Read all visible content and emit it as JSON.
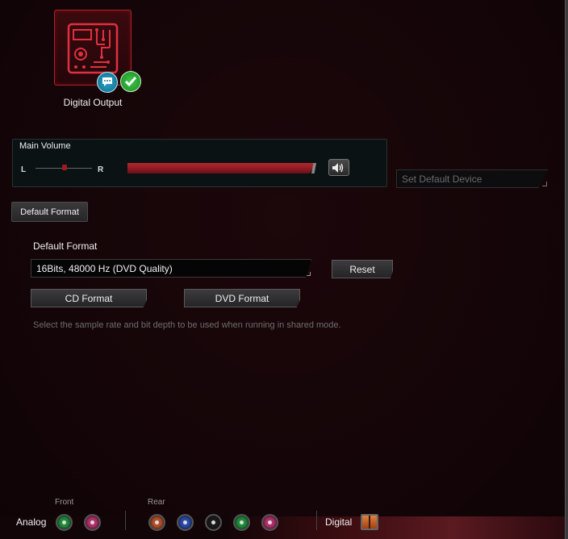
{
  "device": {
    "label": "Digital Output",
    "icon": "circuit-board-icon",
    "badges": [
      "chat-bubble-icon",
      "checkmark-icon"
    ]
  },
  "volume": {
    "title": "Main Volume",
    "left_label": "L",
    "right_label": "R",
    "level_percent": 100,
    "balance_percent": 50,
    "mute_icon": "speaker-icon"
  },
  "set_default_device": {
    "placeholder": "Set Default Device"
  },
  "tabs": {
    "default_format": "Default Format"
  },
  "format": {
    "section_title": "Default Format",
    "selected": "16Bits, 48000 Hz (DVD Quality)",
    "reset_label": "Reset",
    "cd_label": "CD Format",
    "dvd_label": "DVD Format",
    "hint": "Select the sample rate and bit depth to be used when running in shared mode."
  },
  "jacks": {
    "analog_label": "Analog",
    "front_label": "Front",
    "rear_label": "Rear",
    "digital_label": "Digital",
    "front": [
      {
        "name": "front-green",
        "color": "#1f8a3a"
      },
      {
        "name": "front-pink",
        "color": "#b0306a"
      }
    ],
    "rear": [
      {
        "name": "rear-orange",
        "color": "#b0502a"
      },
      {
        "name": "rear-blue",
        "color": "#2a4aa8"
      },
      {
        "name": "rear-black",
        "color": "#1a1a1a"
      },
      {
        "name": "rear-green",
        "color": "#1f8a3a"
      },
      {
        "name": "rear-pink",
        "color": "#b0306a"
      }
    ]
  },
  "colors": {
    "accent": "#b0202a",
    "background": "#120508"
  }
}
